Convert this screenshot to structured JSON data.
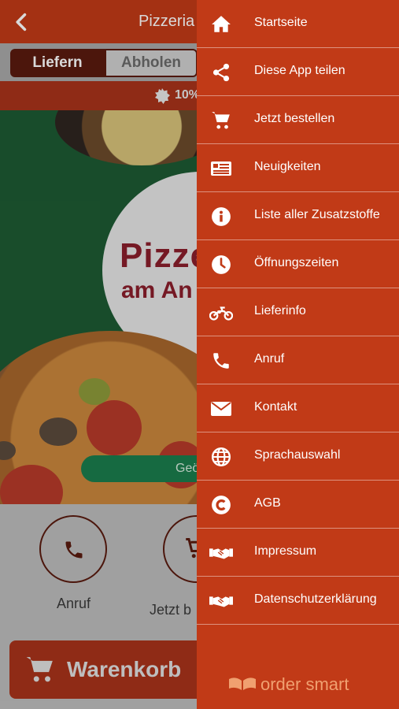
{
  "app": {
    "title": "Pizzeria",
    "tabs": {
      "deliver": "Liefern",
      "pickup": "Abholen"
    },
    "promo_text": "10%",
    "hero": {
      "logo_line1": "Pizze",
      "logo_line2": "am An",
      "status_pill": "Geö"
    },
    "actions": [
      {
        "label": "Anruf",
        "icon": "phone-icon"
      },
      {
        "label": "Jetzt b",
        "icon": "cart-icon"
      }
    ],
    "cart_button": {
      "label": "Warenkorb",
      "icon": "cart-icon"
    }
  },
  "drawer": {
    "items": [
      {
        "label": "Startseite",
        "icon": "home-icon"
      },
      {
        "label": "Diese App teilen",
        "icon": "share-icon"
      },
      {
        "label": "Jetzt bestellen",
        "icon": "cart-icon"
      },
      {
        "label": "Neuigkeiten",
        "icon": "newspaper-icon"
      },
      {
        "label": "Liste aller Zusatzstoffe",
        "icon": "info-icon"
      },
      {
        "label": "Öffnungszeiten",
        "icon": "clock-icon"
      },
      {
        "label": "Lieferinfo",
        "icon": "motorcycle-icon"
      },
      {
        "label": "Anruf",
        "icon": "phone-icon"
      },
      {
        "label": "Kontakt",
        "icon": "envelope-icon"
      },
      {
        "label": "Sprachauswahl",
        "icon": "globe-icon"
      },
      {
        "label": "AGB",
        "icon": "copyright-icon"
      },
      {
        "label": "Impressum",
        "icon": "handshake-icon"
      },
      {
        "label": "Datenschutzerklärung",
        "icon": "handshake-icon"
      }
    ],
    "brand": "order smart"
  },
  "colors": {
    "primary": "#c13a17",
    "dark_brown": "#5a1b0f",
    "green": "#1d5a33",
    "brand_orange": "#f0a070"
  }
}
